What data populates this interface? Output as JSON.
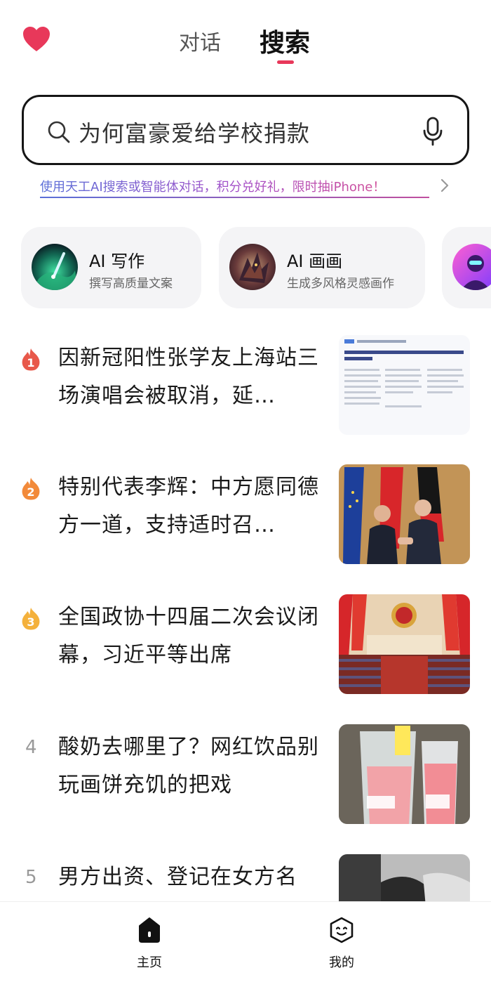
{
  "header": {
    "tabs": [
      {
        "label": "对话",
        "active": false
      },
      {
        "label": "搜索",
        "active": true
      }
    ],
    "accent_color": "#e8385a"
  },
  "search": {
    "placeholder": "为何富豪爱给学校捐款"
  },
  "promo": {
    "text": "使用天工AI搜索或智能体对话，积分兑好礼，限时抽iPhone！"
  },
  "feature_cards": [
    {
      "title": "AI 写作",
      "subtitle": "撰写高质量文案"
    },
    {
      "title": "AI 画画",
      "subtitle": "生成多风格灵感画作"
    },
    {
      "title": "",
      "subtitle": ""
    }
  ],
  "news": [
    {
      "rank": "1",
      "title": "因新冠阳性张学友上海站三场演唱会被取消，延…",
      "badge_color": "#e8584a"
    },
    {
      "rank": "2",
      "title": "特别代表李辉：中方愿同德方一道，支持适时召…",
      "badge_color": "#f28a3a"
    },
    {
      "rank": "3",
      "title": "全国政协十四届二次会议闭幕，习近平等出席",
      "badge_color": "#f4b13c"
    },
    {
      "rank": "4",
      "title": "酸奶去哪里了？网红饮品别玩画饼充饥的把戏"
    },
    {
      "rank": "5",
      "title": "男方出资、登记在女方名"
    }
  ],
  "bottom_nav": [
    {
      "label": "主页",
      "icon": "home-icon",
      "active": true
    },
    {
      "label": "我的",
      "icon": "profile-face-icon",
      "active": false
    }
  ]
}
